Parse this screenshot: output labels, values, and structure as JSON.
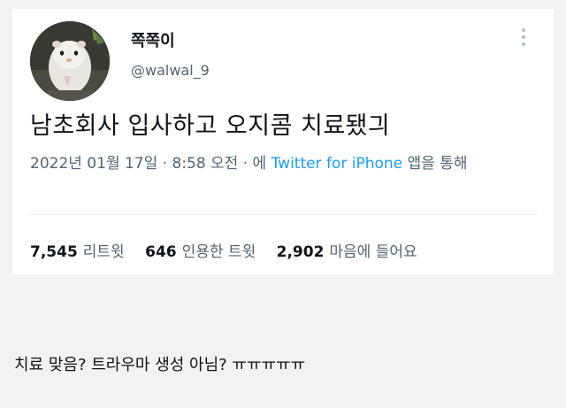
{
  "tweet": {
    "author": {
      "display_name": "쪽쪽이",
      "handle": "@walwal_9",
      "avatar_icon": "hamster-avatar-photo"
    },
    "more_icon": "vertical-dots-icon",
    "text": "남초회사 입사하고 오지콤 치료됐긔",
    "meta": {
      "datetime": "2022년 01월 17일 · 8:58 오전 · ",
      "via_prefix": "에 ",
      "source": "Twitter for iPhone",
      "via_suffix": " 앱을 통해"
    },
    "stats": {
      "retweets_count": "7,545",
      "retweets_label": "리트윗",
      "quotes_count": "646",
      "quotes_label": "인용한 트윗",
      "likes_count": "2,902",
      "likes_label": "마음에 들어요"
    }
  },
  "comment": {
    "text": "치료 맞음? 트라우마 생성 아님? ㅠㅠㅠㅠㅠ"
  },
  "colors": {
    "link": "#1d9bf0",
    "secondary_text": "#536471",
    "primary_text": "#0f1419",
    "page_background": "#f2f2f2"
  }
}
